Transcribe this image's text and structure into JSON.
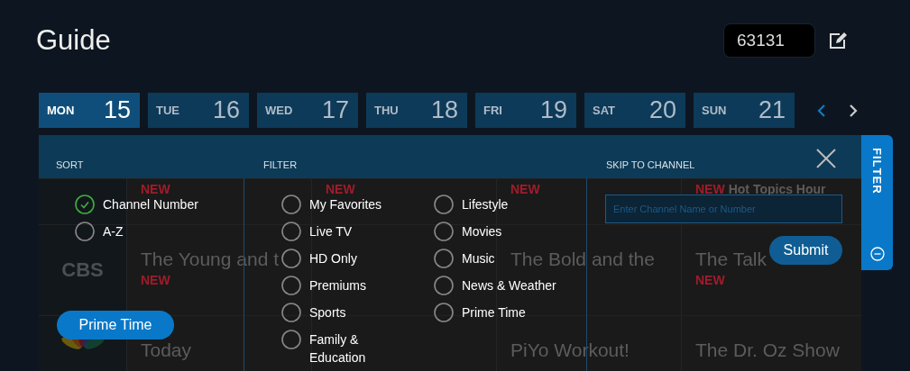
{
  "title": "Guide",
  "zip_code": {
    "value": "63131"
  },
  "days": [
    {
      "weekday": "MON",
      "date": "15",
      "selected": true
    },
    {
      "weekday": "TUE",
      "date": "16",
      "selected": false
    },
    {
      "weekday": "WED",
      "date": "17",
      "selected": false
    },
    {
      "weekday": "THU",
      "date": "18",
      "selected": false
    },
    {
      "weekday": "FRI",
      "date": "19",
      "selected": false
    },
    {
      "weekday": "SAT",
      "date": "20",
      "selected": false
    },
    {
      "weekday": "SUN",
      "date": "21",
      "selected": false
    }
  ],
  "guide_rows": [
    {
      "kind": "plain",
      "programs": [
        {
          "kind": "program",
          "badge": "NEW"
        },
        {
          "kind": "program",
          "badge": "NEW"
        },
        {
          "kind": "program",
          "badge": "NEW"
        },
        {
          "kind": "program",
          "badge": "NEW",
          "subtitle": "Hot Topics Hour"
        }
      ]
    },
    {
      "kind": "text",
      "logo": "CBS",
      "programs": [
        {
          "kind": "program",
          "title": "The Young and t",
          "badge": "NEW"
        },
        {
          "kind": "covered"
        },
        {
          "kind": "program",
          "title": "The Bold and the"
        },
        {
          "kind": "program",
          "title": "The Talk",
          "badge": "NEW"
        }
      ]
    },
    {
      "kind": "icon",
      "programs": [
        {
          "kind": "program",
          "title": "Today"
        },
        {
          "kind": "covered"
        },
        {
          "kind": "program",
          "title": "PiYo Workout!"
        },
        {
          "kind": "program",
          "title": "The Dr. Oz Show"
        }
      ]
    }
  ],
  "sort": {
    "heading": "SORT",
    "options": [
      {
        "label": "Channel Number",
        "selected": true
      },
      {
        "label": "A-Z",
        "selected": false
      }
    ]
  },
  "prime_time_button": "Prime Time",
  "filter": {
    "heading": "FILTER",
    "options": [
      {
        "label": "My Favorites",
        "checked": false
      },
      {
        "label": "Live TV",
        "checked": false
      },
      {
        "label": "HD Only",
        "checked": false
      },
      {
        "label": "Premiums",
        "checked": false
      },
      {
        "label": "Sports",
        "checked": false
      },
      {
        "label": "Family & Education",
        "checked": false
      },
      {
        "label": "Lifestyle",
        "checked": false
      },
      {
        "label": "Movies",
        "checked": false
      },
      {
        "label": "Music",
        "checked": false
      },
      {
        "label": "News & Weather",
        "checked": false
      },
      {
        "label": "Prime Time",
        "checked": false
      }
    ]
  },
  "skip_to_channel": {
    "heading": "SKIP TO CHANNEL",
    "placeholder": "Enter Channel Name or Number",
    "button": "Submit"
  },
  "side_tab": {
    "label": "FILTER"
  }
}
